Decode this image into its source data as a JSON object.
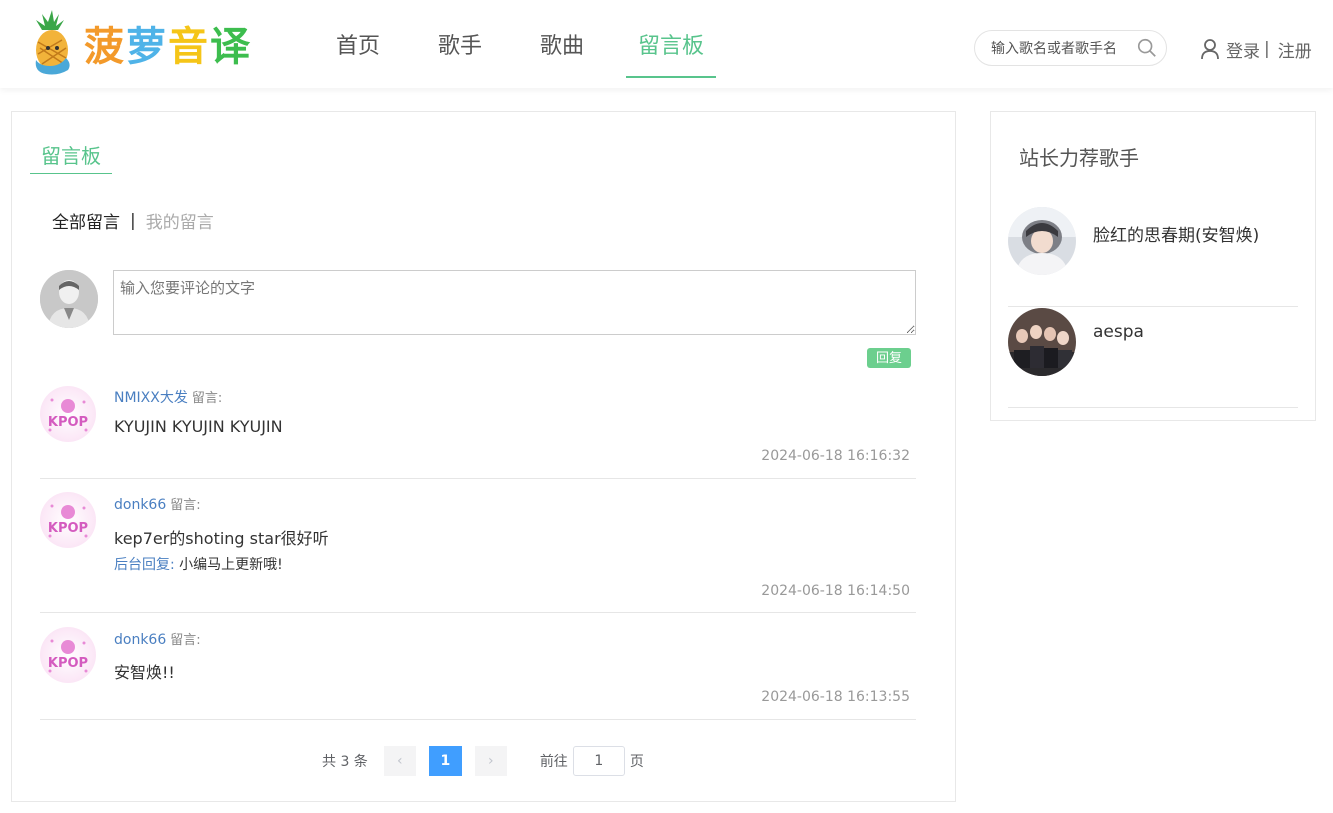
{
  "brand": {
    "chars": [
      "菠",
      "萝",
      "音",
      "译"
    ]
  },
  "nav": [
    {
      "label": "首页"
    },
    {
      "label": "歌手"
    },
    {
      "label": "歌曲"
    },
    {
      "label": "留言板"
    }
  ],
  "search": {
    "placeholder": "输入歌名或者歌手名"
  },
  "auth": {
    "login": "登录",
    "sep": "|",
    "register": "注册"
  },
  "board": {
    "title": "留言板",
    "tabs": {
      "all": "全部留言",
      "sep": "|",
      "mine": "我的留言"
    },
    "composer": {
      "placeholder": "输入您要评论的文字",
      "submit": "回复"
    },
    "label": "留言:",
    "reply_label": "后台回复:",
    "comments": [
      {
        "user": "NMIXX大发",
        "text": "KYUJIN KYUJIN KYUJIN",
        "reply": "",
        "time": "2024-06-18 16:16:32"
      },
      {
        "user": "donk66",
        "text": "kep7er的shoting star很好听",
        "reply": "小编马上更新哦!",
        "time": "2024-06-18 16:14:50"
      },
      {
        "user": "donk66",
        "text": "安智焕!!",
        "reply": "",
        "time": "2024-06-18 16:13:55"
      }
    ]
  },
  "pagination": {
    "total": "共 3 条",
    "prev": "‹",
    "page": "1",
    "next": "›",
    "goto": "前往",
    "input": "1",
    "unit": "页"
  },
  "side": {
    "title": "站长力荐歌手",
    "singers": [
      {
        "name": "脸红的思春期(安智焕)"
      },
      {
        "name": "aespa"
      }
    ]
  }
}
